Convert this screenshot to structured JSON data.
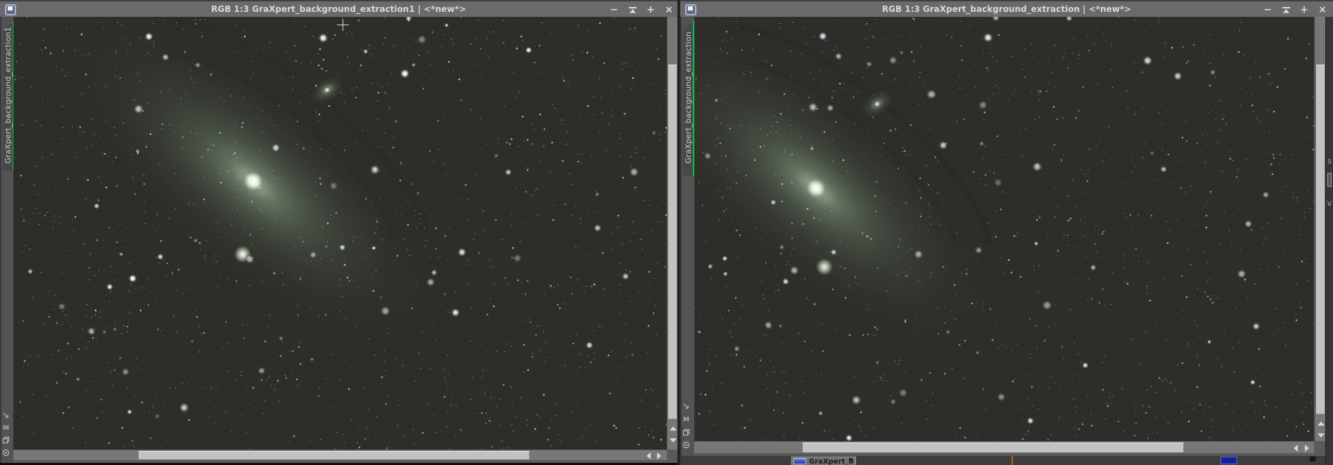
{
  "windows": [
    {
      "title": "RGB 1:3 GraXpert_background_extraction1 | <*new*>",
      "tab_label": "GraXpert_background_extraction1",
      "buttons": {
        "minimize": "−",
        "maximize": "+",
        "close": "×"
      },
      "image_description": "Green-tinted deep-sky starfield showing the Andromeda galaxy M31 tilted diagonally, companion galaxy M110 above right of the core and bright M32 below the core"
    },
    {
      "title": "RGB 1:3 GraXpert_background_extraction | <*new*>",
      "tab_label": "GraXpert_background_extraction",
      "buttons": {
        "minimize": "−",
        "maximize": "+",
        "close": "×"
      },
      "image_description": "Green-tinted deep-sky starfield showing the Andromeda galaxy M31 tilted diagonally, companion galaxy M110 above right of the core and bright M32 below the core"
    }
  ],
  "sidebar_icons": [
    "pan-arrow",
    "fit-view",
    "duplicate-view",
    "center-dot"
  ],
  "taskbar": {
    "item_label": "GraXpert_b",
    "badge": "N"
  },
  "edge_fragments": {
    "text_top": "S",
    "text_bottom": "V"
  },
  "colors": {
    "titlebar": "#6a6a6a",
    "tab_stripe": "#00c853",
    "scrollbar_thumb": "#c2c2c2",
    "sidebar": "#535353",
    "workspace": "#242424"
  }
}
